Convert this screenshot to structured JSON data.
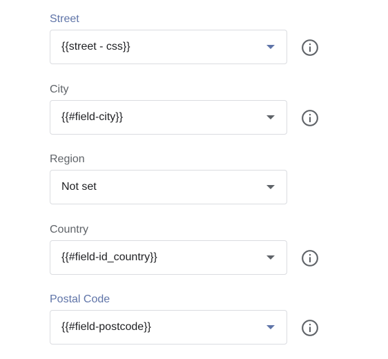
{
  "fields": [
    {
      "label": "Street",
      "value": "{{street - css}}",
      "has_info": true,
      "focused": true
    },
    {
      "label": "City",
      "value": "{{#field-city}}",
      "has_info": true,
      "focused": false
    },
    {
      "label": "Region",
      "value": "Not set",
      "has_info": false,
      "focused": false
    },
    {
      "label": "Country",
      "value": "{{#field-id_country}}",
      "has_info": true,
      "focused": false
    },
    {
      "label": "Postal Code",
      "value": "{{#field-postcode}}",
      "has_info": true,
      "focused": true
    }
  ],
  "icons": {
    "info": "info-circle-icon",
    "dropdown": "caret-down-icon"
  },
  "colors": {
    "accent_label": "#5f74a8",
    "label": "#5f6368",
    "border": "#dadce0",
    "text": "#202124"
  }
}
